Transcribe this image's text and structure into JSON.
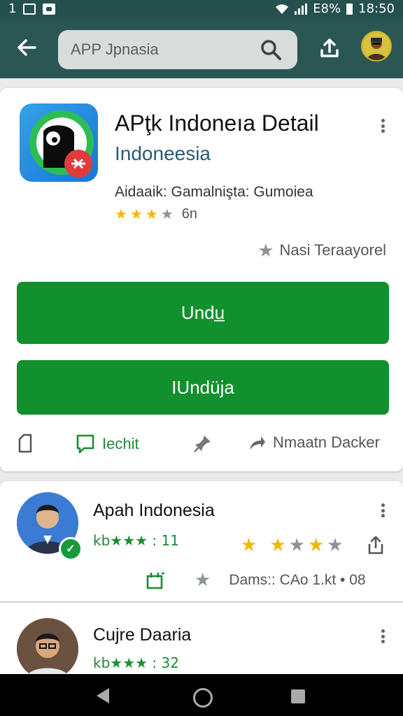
{
  "status": {
    "time_left": "1",
    "battery": "E8%",
    "clock": "18:50"
  },
  "search": {
    "placeholder": "APP Jpnasia"
  },
  "app": {
    "title": "APţk Indoneıa Detail",
    "subtitle": "Indoneesia",
    "meta": "Aidaaik: Gamalnişta: Gumoiea",
    "rating_text": "6n",
    "favorite_label": "Nasi Teraayorel",
    "button_primary": "Undu̲",
    "button_secondary": "IUndüja",
    "actions": [
      {
        "icon": "bookmark-icon",
        "label": ""
      },
      {
        "icon": "chat-icon",
        "label": "Iechit"
      },
      {
        "icon": "pin-icon",
        "label": ""
      },
      {
        "icon": "share-arrow-icon",
        "label": "Nmaatn Dacker"
      }
    ]
  },
  "reviews": [
    {
      "name": "Apah Indonesia",
      "sub": "kb★★★ : 11",
      "footer": "Dams:: CAo  1.kt  • 08"
    },
    {
      "name": "Cujre Daaria",
      "sub": "kb★★★ : 32"
    }
  ],
  "colors": {
    "appbar": "#2a5753",
    "accent_green": "#12902d",
    "star_gold": "#f2b707"
  }
}
